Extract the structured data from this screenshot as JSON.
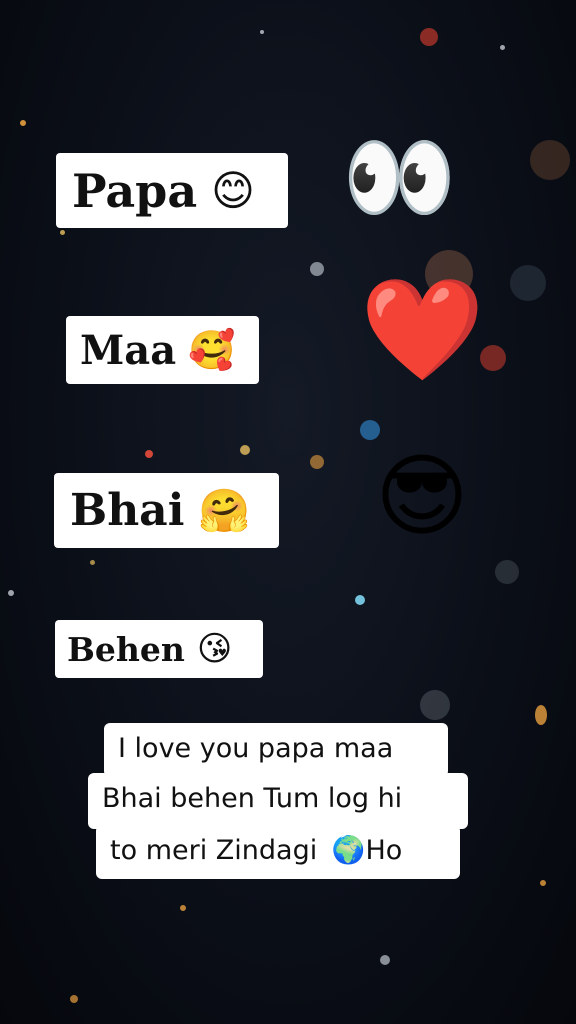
{
  "labels": {
    "papa": {
      "text": "Papa",
      "emoji": "😊"
    },
    "maa": {
      "text": "Maa",
      "emoji": "🥰"
    },
    "bhai": {
      "text": "Bhai",
      "emoji": "🤗"
    },
    "behen": {
      "text": "Behen",
      "emoji": "😘"
    }
  },
  "side_emojis": {
    "eyes": "👀",
    "heart": "❤️",
    "sunglasses": "😎"
  },
  "caption": {
    "line1": "I love you papa maa",
    "line2": "Bhai behen Tum log hi",
    "line3": "to meri Zindagi",
    "globe": "🌍",
    "line3_end": "Ho"
  }
}
